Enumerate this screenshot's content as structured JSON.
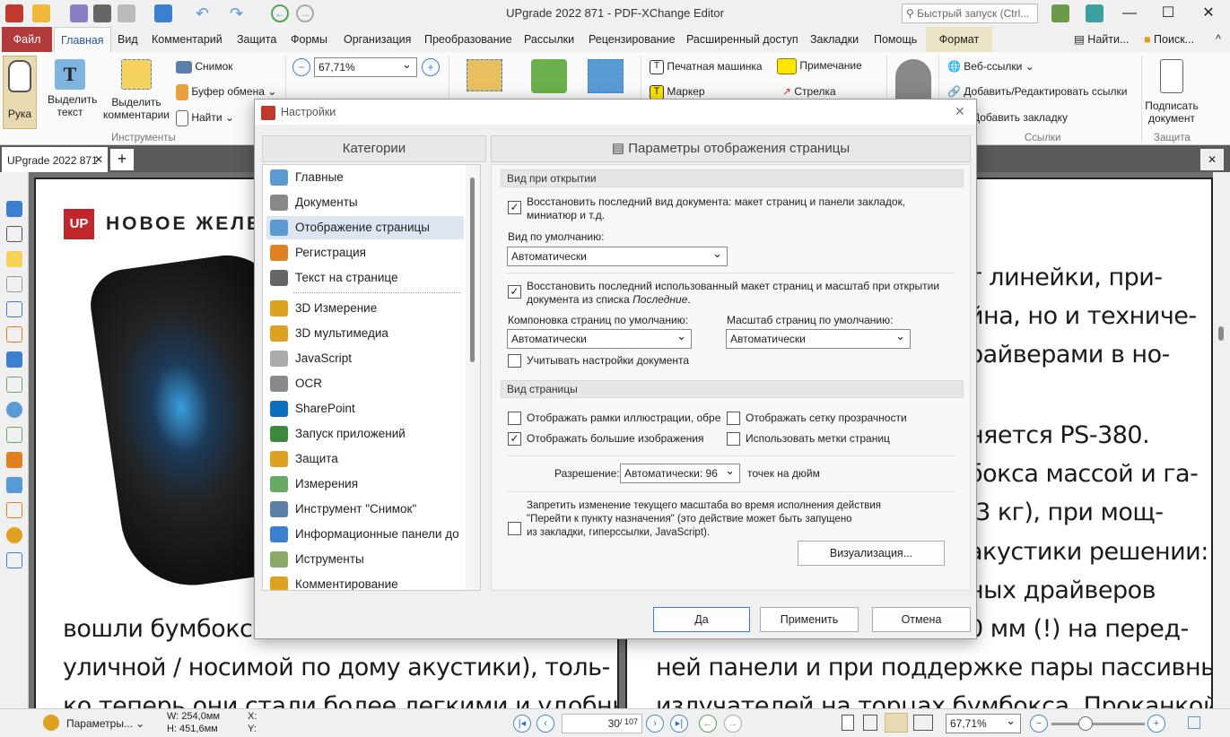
{
  "window": {
    "title": "UPgrade 2022 871 - PDF-XChange Editor",
    "quick_launch_placeholder": "Быстрый запуск (Ctrl...",
    "min": "—",
    "max": "☐",
    "close": "✕"
  },
  "menu_tabs": [
    "Файл",
    "Главная",
    "Вид",
    "Комментарий",
    "Защита",
    "Формы",
    "Организация",
    "Преобразование",
    "Рассылки",
    "Рецензирование",
    "Расширенный доступ",
    "Закладки",
    "Помощь",
    "Формат"
  ],
  "menu_right": {
    "find": "Найти...",
    "search": "Поиск...",
    "collapse": "^"
  },
  "ribbon": {
    "hand": "Рука",
    "select_text": "Выделить текст",
    "select_comments": "Выделить комментарии",
    "snapshot": "Снимок",
    "clipboard": "Буфер обмена",
    "find": "Найти",
    "group_tools": "Инструменты",
    "zoom_value": "67,71%",
    "typewriter": "Печатная машинка",
    "note": "Примечание",
    "marker": "Маркер",
    "arrow": "Стрелка",
    "web_links": "Веб-ссылки",
    "add_edit_links": "Добавить/Редактировать ссылки",
    "add_bookmark": "Добавить закладку",
    "group_links": "Ссылки",
    "sign": "Подписать документ",
    "group_protect": "Защита"
  },
  "doc_tab": {
    "label": "UPgrade 2022 871",
    "close": "✕",
    "add": "+"
  },
  "document": {
    "logo": "UP",
    "header": "НОВОЕ ЖЕЛЕЗО",
    "left_lines": [
      "вошли бумбоксы",
      "уличной / носимой по дому акустики), толь-",
      "ко теперь они стали более легкими и удобны-"
    ],
    "right_lines": [
      "т линейки, при-",
      "йна, но и техниче-",
      "райверами в но-",
      "няется PS-380.",
      "бокса массой и га-",
      ",3 кг), при мощ-",
      "акустики решении:",
      "ных драйверов",
      "0 мм (!) на перед-",
      "ней панели и при поддержке пары пассивных",
      "излучателей на торцах бумбокса. Проканкой"
    ]
  },
  "dialog": {
    "title": "Настройки",
    "close": "✕",
    "categories_header": "Категории",
    "categories": [
      "Главные",
      "Документы",
      "Отображение страницы",
      "Регистрация",
      "Текст на странице",
      "3D Измерение",
      "3D мультимедиа",
      "JavaScript",
      "OCR",
      "SharePoint",
      "Запуск приложений",
      "Защита",
      "Измерения",
      "Инструмент \"Снимок\"",
      "Информационные панели до",
      "Иструменты",
      "Комментирование"
    ],
    "selected_category": "Отображение страницы",
    "panel_header": "Параметры отображения страницы",
    "section_open": "Вид при открытии",
    "restore_view": {
      "checked": true,
      "label1": "Восстановить последний вид документа: макет страниц и панели закладок,",
      "label2": "миниатюр и т.д."
    },
    "default_view_label": "Вид по умолчанию:",
    "default_view": "Автоматически",
    "restore_layout": {
      "checked": true,
      "label1": "Восстановить последний использованный макет страниц и масштаб при открытии",
      "label2": "документа из списка ",
      "label2_italic": "Последние",
      "label2_end": "."
    },
    "layout_label": "Компоновка страниц по умолчанию:",
    "layout_value": "Автоматически",
    "zoom_label": "Масштаб страниц по умолчанию:",
    "zoom_value": "Автоматически",
    "doc_settings": {
      "checked": false,
      "label": "Учитывать настройки документа"
    },
    "section_page": "Вид страницы",
    "show_art": {
      "checked": false,
      "label": "Отображать рамки иллюстрации, обре"
    },
    "show_grid": {
      "checked": false,
      "label": "Отображать сетку прозрачности"
    },
    "show_large": {
      "checked": true,
      "label": "Отображать большие изображения"
    },
    "use_labels": {
      "checked": false,
      "label": "Использовать метки страниц"
    },
    "resolution_label": "Разрешение:",
    "resolution_value": "Автоматически: 96",
    "resolution_unit": "точек на дюйм",
    "prevent_zoom": {
      "checked": false,
      "label1": "Запретить изменение текущего масштаба во время исполнения действия",
      "label2": "\"Перейти к пункту назначения\" (это действие может быть запущено",
      "label3": "из закладки, гиперссылки,  JavaScript)."
    },
    "visualization": "Визуализация...",
    "ok": "Да",
    "apply": "Применить",
    "cancel": "Отмена"
  },
  "status": {
    "settings": "Параметры...",
    "width": "W: 254,0мм",
    "height": "H: 451,6мм",
    "x": "X:",
    "y": "Y:",
    "page_current": "30",
    "page_total": "/ 107",
    "zoom": "67,71%"
  }
}
